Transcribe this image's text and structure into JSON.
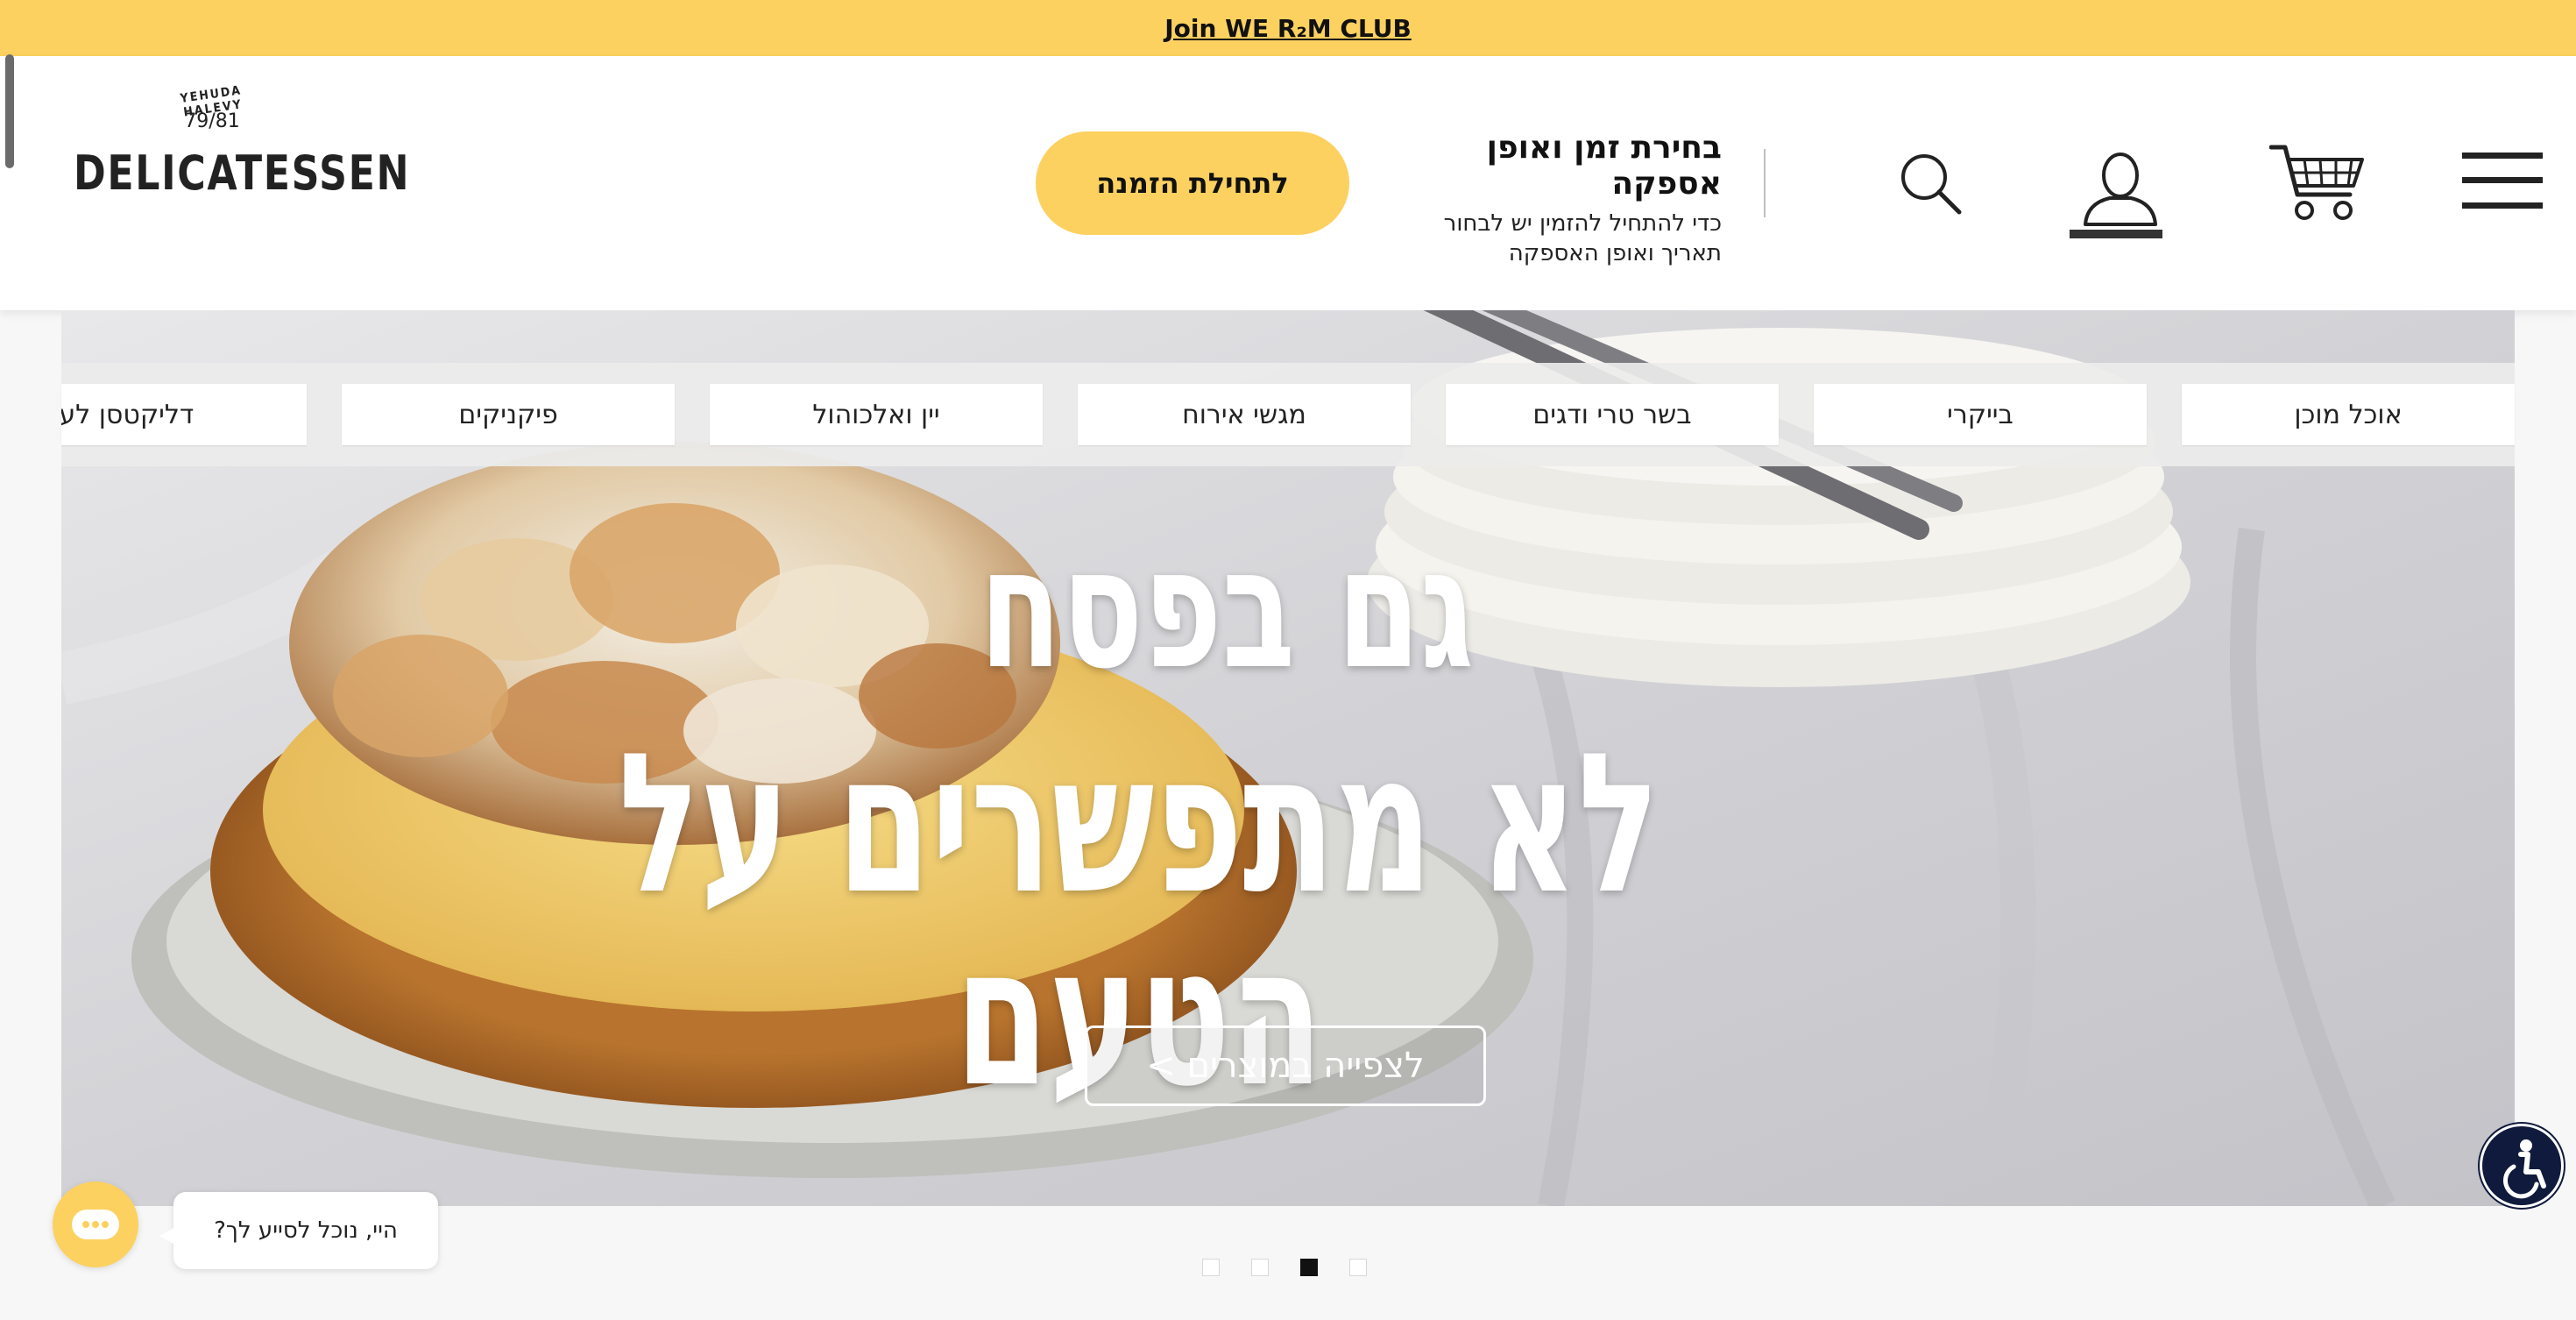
{
  "promo": {
    "link_label": "Join WE R₂M CLUB"
  },
  "header": {
    "logo": {
      "arc_text": "YEHUDA HALEVY",
      "number": "79/81",
      "word": "DELICATESSEN"
    },
    "order_button_label": "לתחילת הזמנה",
    "delivery": {
      "title": "בחירת זמן ואופן אספקה",
      "line1": "כדי להתחיל להזמין יש לבחור",
      "line2": "תאריך ואופן האספקה"
    },
    "icons": [
      "search-icon",
      "user-icon",
      "cart-icon",
      "menu-icon"
    ]
  },
  "categories": [
    "אוכל מוכן",
    "בייקרי",
    "בשר טרי ודגים",
    "מגשי אירוח",
    "יין ואלכוהול",
    "פיקניקים",
    "דליקטסן לעסקים"
  ],
  "hero": {
    "headline_line1": "גם בפסח",
    "headline_line2": "לא מתפשרים על הטעם",
    "cta_label": "לצפייה במוצרים >"
  },
  "slider": {
    "dots": 4,
    "active_index": 2
  },
  "chat": {
    "message": "היי, נוכל לסייע לך?"
  },
  "colors": {
    "accent_yellow": "#fcd15f",
    "access_navy": "#0f1a3c"
  }
}
